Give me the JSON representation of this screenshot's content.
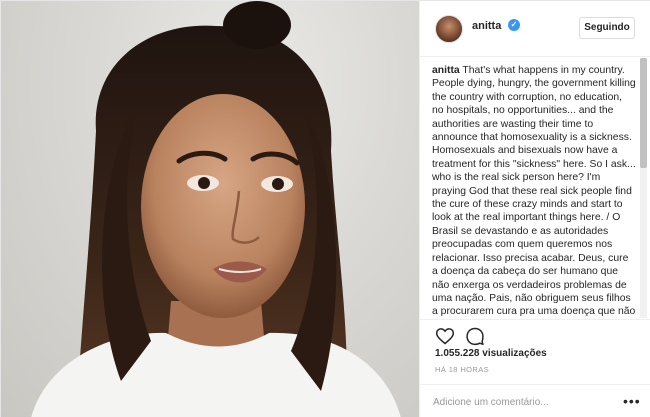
{
  "post": {
    "username": "anitta",
    "verified": true,
    "follow_label": "Seguindo",
    "caption_user": "anitta",
    "caption_text": "That's what happens in my country. People dying, hungry, the government killing the country with corruption, no education, no hospitals, no opportunities... and the authorities are wasting their time to announce that homosexuality is a sickness. Homosexuals and bisexuals now have a treatment for this \"sickness\" here. So I ask... who is the real sick person here? I'm praying God that these real sick people find the cure of these crazy minds and start to look at the real important things here. / O Brasil se devastando e as autoridades preocupadas com quem queremos nos relacionar. Isso precisa acabar. Deus, cure a doença da cabeça do ser humano que não enxerga os verdadeiros problemas de uma nação. Pais, não obriguem seus filhos a procurarem cura pra uma doença que não existe, baseados neste fato político. Essa",
    "views": "1.055.228 visualizações",
    "time": "HÁ 18 HORAS",
    "comment_placeholder": "Adicione um comentário...",
    "more_label": "•••"
  },
  "icons": {
    "like": "heart-icon",
    "comment": "comment-icon",
    "verified": "verified-badge-icon",
    "more": "more-options-icon"
  },
  "colors": {
    "verified_blue": "#3897f0",
    "border": "#efefef",
    "muted_text": "#999999"
  }
}
